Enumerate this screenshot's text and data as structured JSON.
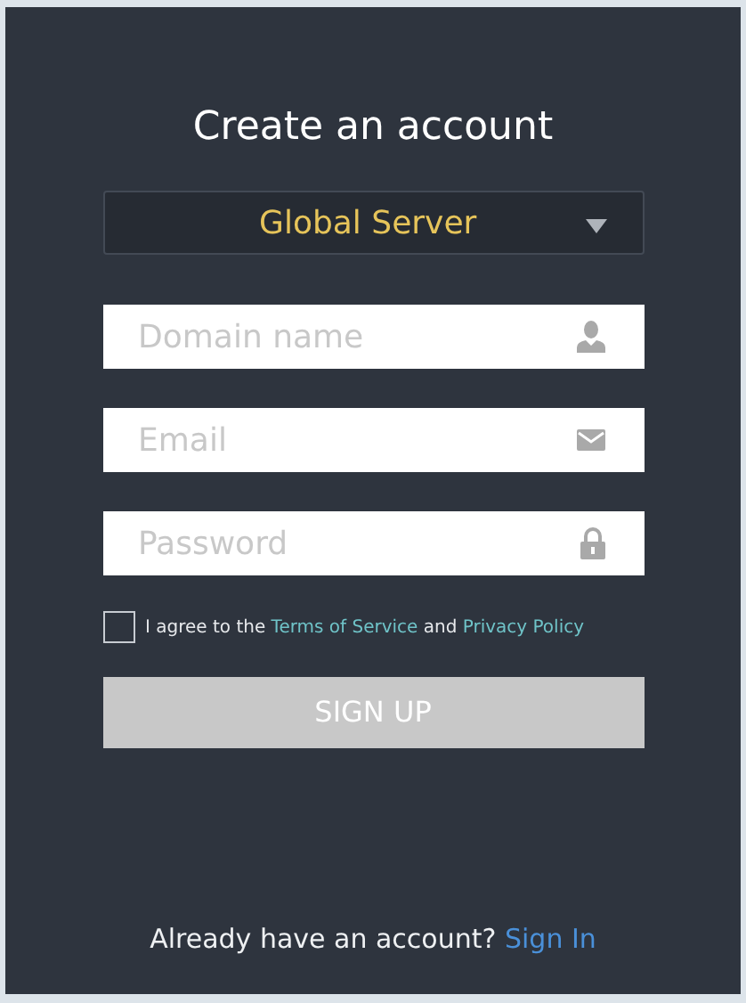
{
  "title": "Create an account",
  "server_select": {
    "value": "Global Server"
  },
  "fields": [
    {
      "placeholder": "Domain name",
      "kind": "user"
    },
    {
      "placeholder": "Email",
      "kind": "email"
    },
    {
      "placeholder": "Password",
      "kind": "password"
    }
  ],
  "agreement": {
    "checked": false,
    "prefix": "I agree to the",
    "terms_link": "Terms of Service",
    "conjunction": "and",
    "privacy_link": "Privacy Policy"
  },
  "signup_button": {
    "label": "SIGN UP",
    "disabled": true
  },
  "footer": {
    "prompt": "Already have an account?",
    "link": "Sign In"
  }
}
